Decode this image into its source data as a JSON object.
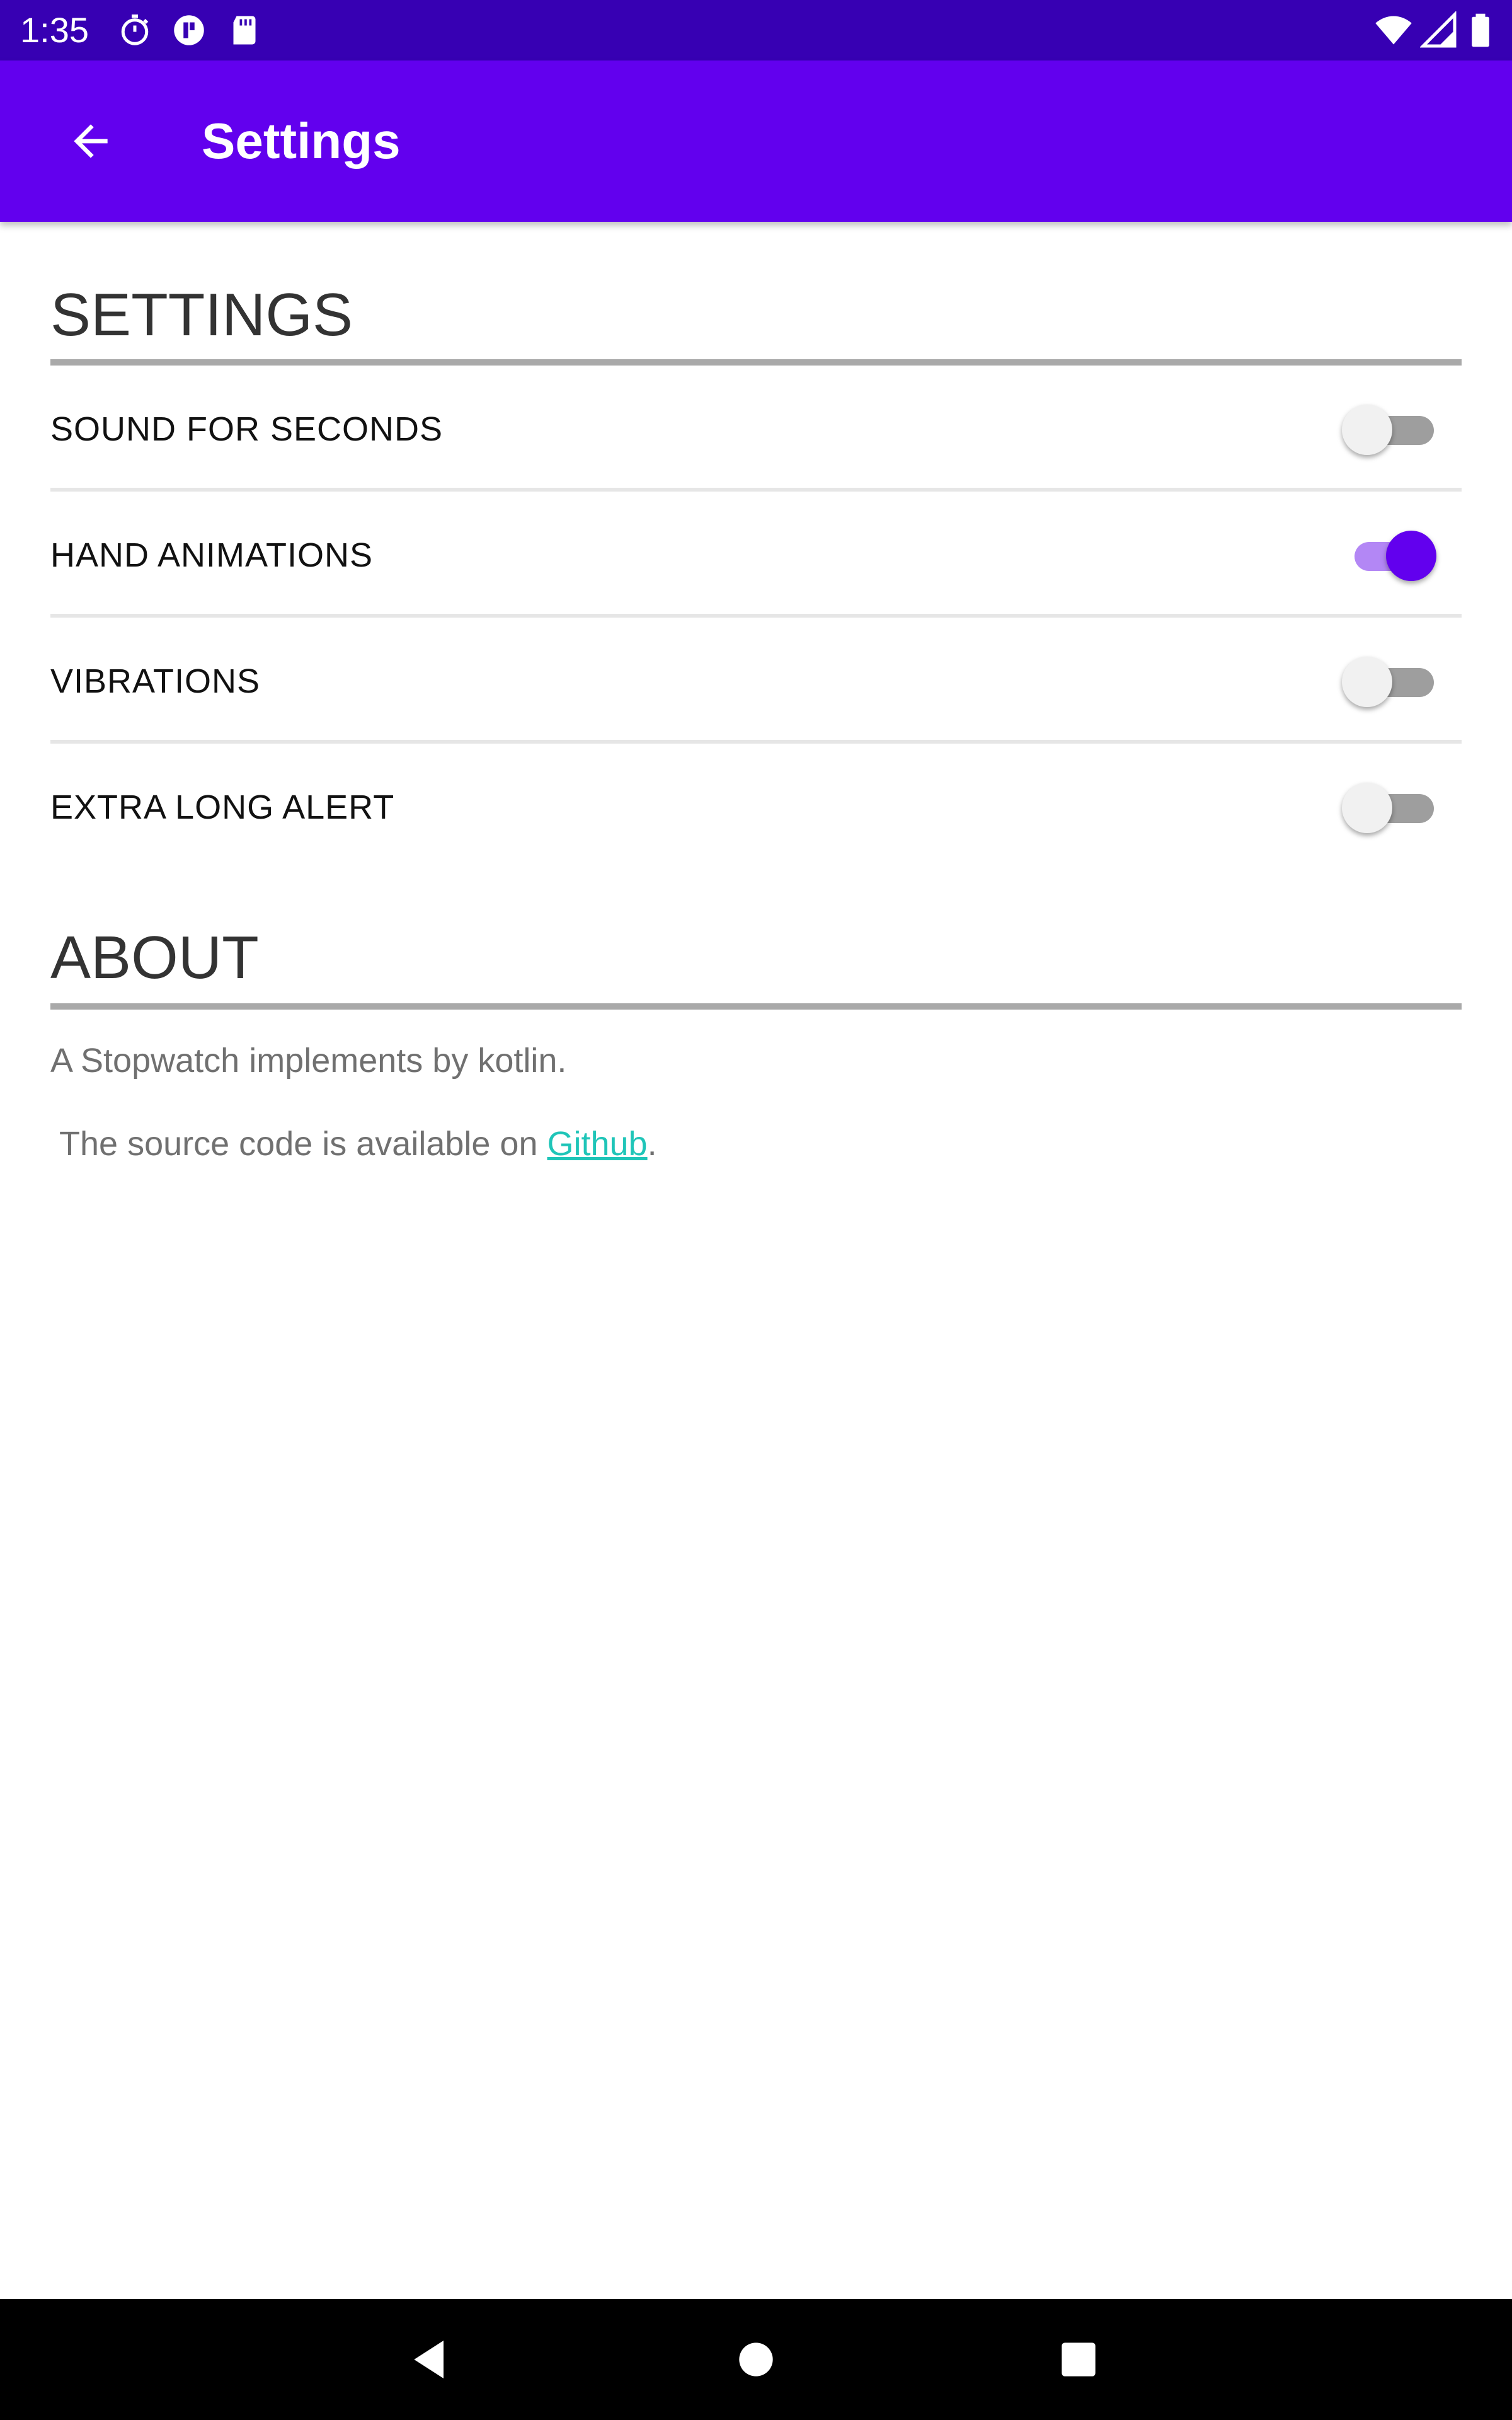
{
  "status_bar": {
    "time": "1:35",
    "icons": [
      "stopwatch-icon",
      "badge-icon",
      "sd-card-icon",
      "wifi-icon",
      "cell-signal-icon",
      "battery-icon"
    ]
  },
  "app_bar": {
    "title": "Settings",
    "back_icon": "arrow-back-icon"
  },
  "settings_section": {
    "header": "SETTINGS",
    "items": [
      {
        "label": "SOUND FOR SECONDS",
        "enabled": false
      },
      {
        "label": "HAND ANIMATIONS",
        "enabled": true
      },
      {
        "label": "VIBRATIONS",
        "enabled": false
      },
      {
        "label": "EXTRA LONG ALERT",
        "enabled": false
      }
    ]
  },
  "about_section": {
    "header": "ABOUT",
    "description": "A Stopwatch implements by kotlin.",
    "source_prefix": " The source code is available on ",
    "source_link": "Github",
    "source_suffix": "."
  },
  "nav_bar": {
    "buttons": [
      "back-triangle-icon",
      "home-circle-icon",
      "recents-square-icon"
    ]
  },
  "colors": {
    "status_bar": "#3700b3",
    "app_bar": "#6200ee",
    "switch_on_thumb": "#6200ee",
    "switch_on_track": "#b387f5",
    "link": "#1fc5b8"
  }
}
